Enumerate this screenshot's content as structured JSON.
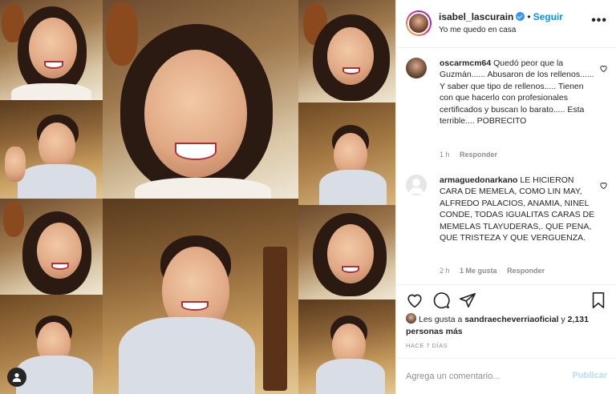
{
  "post": {
    "username": "isabel_lascurain",
    "follow_label": "Seguir",
    "separator": "•",
    "location": "Yo me quedo en casa",
    "more_label": "•••"
  },
  "comments": [
    {
      "username": "oscarmcm64",
      "text": "Quedó peor que la Guzmán...... Abusaron de los rellenos...... Y saber que tipo de rellenos..... Tienen con que hacerlo con profesionales certificados y buscan lo barato..... Esta terrible.... POBRECITO",
      "time": "1 h",
      "reply": "Responder"
    },
    {
      "username": "armaguedonarkano",
      "text": "LE HICIERON CARA DE MEMELA, COMO LIN MAY, ALFREDO PALACIOS, ANAMIA, NINEL CONDE, TODAS IGUALITAS CARAS DE MEMELAS TLAYUDERAS,. QUE PENA, QUE TRISTEZA Y QUE VERGUENZA.",
      "time": "2 h",
      "likes": "1 Me gusta",
      "reply": "Responder"
    }
  ],
  "likes": {
    "prefix": "Les gusta a",
    "user": "sandraecheverriaoficial",
    "conj": "y",
    "count": "2,131 personas más"
  },
  "time_ago": "HACE 7 DÍAS",
  "add_comment": {
    "placeholder": "Agrega un comentario...",
    "publish_label": "Publicar"
  },
  "icons": {
    "heart": "heart-icon",
    "comment": "comment-icon",
    "share": "share-icon",
    "save": "bookmark-icon",
    "user_tag": "user-icon",
    "verified": "verified-badge-icon"
  },
  "colors": {
    "accent": "#0095f6",
    "verified": "#3897f0",
    "muted": "#8e8e8e",
    "publish_disabled": "#b2dffc"
  }
}
